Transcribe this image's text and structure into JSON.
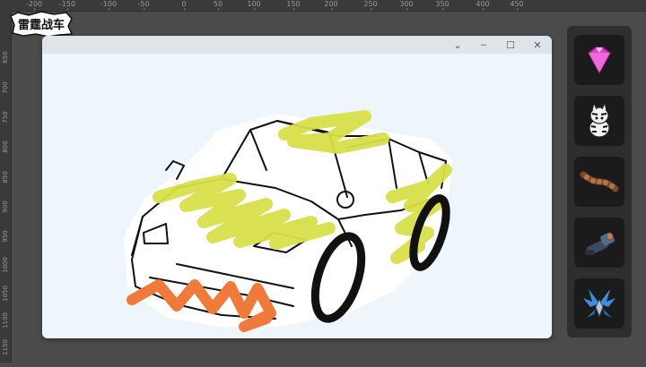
{
  "ruler": {
    "top_ticks": [
      "-200",
      "-150",
      "-100",
      "-50",
      "0",
      "50",
      "100",
      "150",
      "200",
      "250",
      "300",
      "350",
      "400",
      "450"
    ],
    "left_ticks": [
      "650",
      "700",
      "750",
      "800",
      "850",
      "900",
      "950",
      "1000",
      "1050",
      "1100",
      "1150"
    ]
  },
  "logo": {
    "text": "雷霆战车"
  },
  "window": {
    "minimize_glyph": "–",
    "maximize_glyph": "☐",
    "close_glyph": "✕",
    "dropdown_glyph": "⌄"
  },
  "items": [
    {
      "name": "gem-icon"
    },
    {
      "name": "zebra-mascot-icon"
    },
    {
      "name": "spiked-chain-icon"
    },
    {
      "name": "cannon-icon"
    },
    {
      "name": "mech-wings-icon"
    }
  ],
  "colors": {
    "scribble_yellow": "#d8e04a",
    "scribble_orange": "#f07a3a",
    "canvas_bg": "#eef6fc",
    "panel_bg": "#2e2e2e"
  }
}
